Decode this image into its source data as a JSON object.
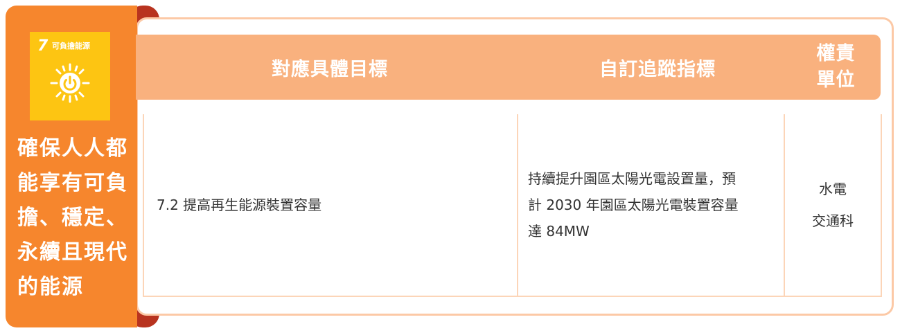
{
  "goal": {
    "sdg_number": "7",
    "sdg_name": "可負擔能源",
    "icon": "sun-power-icon",
    "title": "確保人人都能享有可負擔、穩定、永續且現代的能源",
    "colors": {
      "panel": "#f6862d",
      "icon_bg": "#fdc512",
      "tab": "#b8331f"
    }
  },
  "table": {
    "headers": [
      "對應具體目標",
      "自訂追蹤指標",
      "權責\n單位"
    ],
    "rows": [
      {
        "target": "7.2 提高再生能源裝置容量",
        "indicator": "持續提升園區太陽光電設置量，預\n計 2030 年園區太陽光電裝置容量\n達 84MW",
        "unit": "水電\n交通科"
      }
    ],
    "colors": {
      "header_bg": "#f9b17e",
      "border": "#fcd5b8"
    }
  }
}
